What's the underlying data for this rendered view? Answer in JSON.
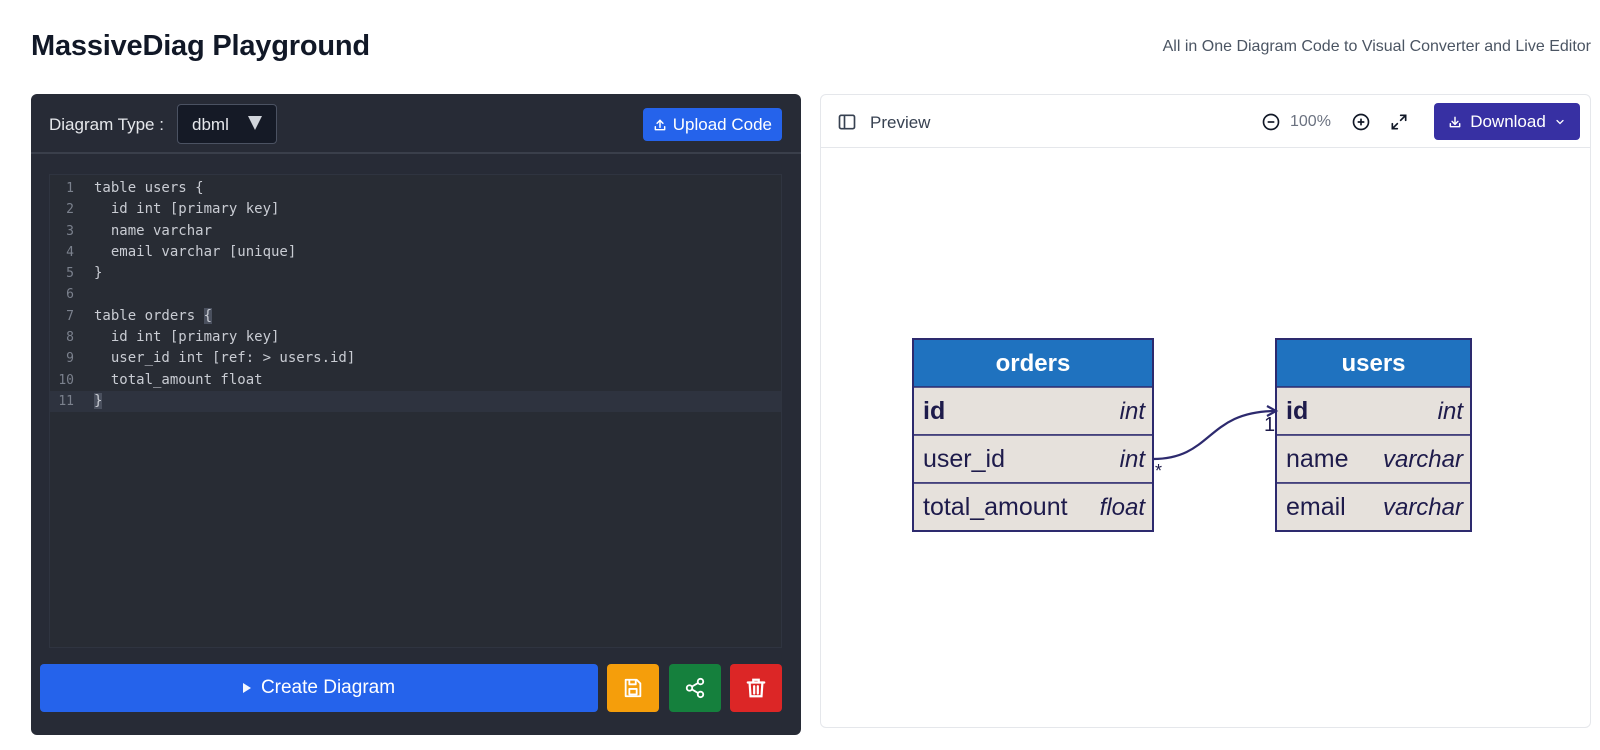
{
  "header": {
    "title": "MassiveDiag Playground",
    "subtitle": "All in One Diagram Code to Visual Converter and Live Editor"
  },
  "editor": {
    "type_label": "Diagram Type :",
    "type_value": "dbml",
    "upload_label": "Upload Code",
    "code_lines": [
      "table users {",
      "  id int [primary key]",
      "  name varchar",
      "  email varchar [unique]",
      "}",
      "",
      "table orders {",
      "  id int [primary key]",
      "  user_id int [ref: > users.id]",
      "  total_amount float",
      "}"
    ],
    "active_line": 11
  },
  "actions": {
    "create_label": "Create Diagram",
    "save_icon": "save-icon",
    "share_icon": "share-icon",
    "delete_icon": "trash-icon"
  },
  "preview": {
    "label": "Preview",
    "zoom_level": "100%",
    "download_label": "Download"
  },
  "diagram": {
    "tables": [
      {
        "name": "orders",
        "columns": [
          {
            "name": "id",
            "type": "int",
            "pk": true
          },
          {
            "name": "user_id",
            "type": "int",
            "pk": false
          },
          {
            "name": "total_amount",
            "type": "float",
            "pk": false
          }
        ]
      },
      {
        "name": "users",
        "columns": [
          {
            "name": "id",
            "type": "int",
            "pk": true
          },
          {
            "name": "name",
            "type": "varchar",
            "pk": false
          },
          {
            "name": "email",
            "type": "varchar",
            "pk": false
          }
        ]
      }
    ],
    "relation": {
      "from_label": "*",
      "to_label": "1"
    }
  },
  "colors": {
    "primary": "#2563eb",
    "table_header": "#1f72bf",
    "table_row": "#e6e1dc",
    "table_border": "#2d2a6e",
    "save": "#f59e0b",
    "share": "#15803d",
    "delete": "#dc2626",
    "download": "#3730a3"
  }
}
